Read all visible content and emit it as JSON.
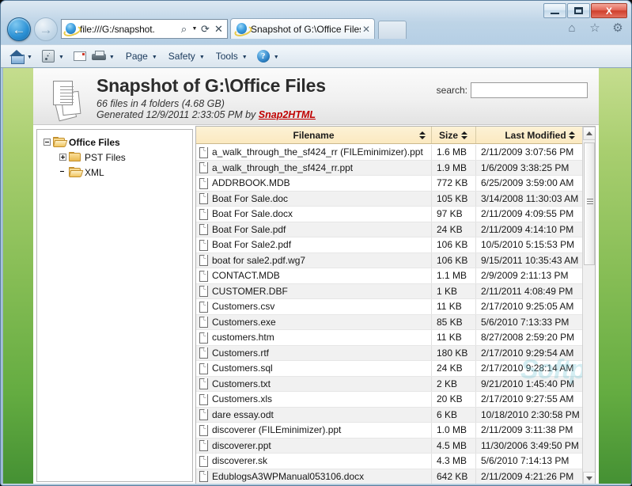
{
  "window": {
    "minimize_label": "Minimize",
    "maximize_label": "Maximize",
    "close_label": "X"
  },
  "browser": {
    "back_glyph": "←",
    "forward_glyph": "→",
    "address_value": "file:///G:/snapshot.",
    "address_search_glyph": "⌕",
    "address_caret_glyph": "▼",
    "address_refresh_glyph": "⟳",
    "address_stop_glyph": "✕",
    "tab_title": "Snapshot of G:\\Office Files",
    "tab_close_glyph": "✕",
    "home_glyph": "⌂",
    "favorites_glyph": "☆",
    "settings_glyph": "⚙"
  },
  "commandbar": {
    "items": [
      {
        "icon": "home-icon",
        "label": "",
        "caret": "▼"
      },
      {
        "icon": "rss-feeds-icon",
        "label": "",
        "caret": "▼"
      },
      {
        "icon": "mail-icon",
        "label": "",
        "caret": ""
      },
      {
        "icon": "print-icon",
        "label": "",
        "caret": "▼"
      },
      {
        "icon": "",
        "label": "Page",
        "caret": "▼"
      },
      {
        "icon": "",
        "label": "Safety",
        "caret": "▼"
      },
      {
        "icon": "",
        "label": "Tools",
        "caret": "▼"
      },
      {
        "icon": "help-icon",
        "label": "",
        "caret": "▼"
      }
    ]
  },
  "page_header": {
    "title": "Snapshot of G:\\Office Files",
    "subtitle_counts": "66 files in 4 folders (4.68 GB)",
    "subtitle_generated_prefix": "Generated 12/9/2011 2:33:05 PM by ",
    "generator_link": "Snap2HTML",
    "search_label": "search:",
    "search_value": "",
    "search_placeholder": ""
  },
  "tree": {
    "nodes": [
      {
        "label": "Office Files",
        "level": 1,
        "state": "expanded",
        "folder": "open",
        "selected": true
      },
      {
        "label": "PST Files",
        "level": 2,
        "state": "collapsed",
        "folder": "closed",
        "selected": false
      },
      {
        "label": "XML",
        "level": 2,
        "state": "leaf",
        "folder": "open",
        "selected": false
      }
    ]
  },
  "filelist": {
    "columns": [
      "Filename",
      "Size",
      "Last Modified"
    ],
    "sort_glyph": "⇅",
    "rows": [
      {
        "name": "a_walk_through_the_sf424_rr (FILEminimizer).ppt",
        "size": "1.6 MB",
        "modified": "2/11/2009 3:07:56 PM"
      },
      {
        "name": "a_walk_through_the_sf424_rr.ppt",
        "size": "1.9 MB",
        "modified": "1/6/2009 3:38:25 PM"
      },
      {
        "name": "ADDRBOOK.MDB",
        "size": "772 KB",
        "modified": "6/25/2009 3:59:00 AM"
      },
      {
        "name": "Boat For Sale.doc",
        "size": "105 KB",
        "modified": "3/14/2008 11:30:03 AM"
      },
      {
        "name": "Boat For Sale.docx",
        "size": "97 KB",
        "modified": "2/11/2009 4:09:55 PM"
      },
      {
        "name": "Boat For Sale.pdf",
        "size": "24 KB",
        "modified": "2/11/2009 4:14:10 PM"
      },
      {
        "name": "Boat For Sale2.pdf",
        "size": "106 KB",
        "modified": "10/5/2010 5:15:53 PM"
      },
      {
        "name": "boat for sale2.pdf.wg7",
        "size": "106 KB",
        "modified": "9/15/2011 10:35:43 AM"
      },
      {
        "name": "CONTACT.MDB",
        "size": "1.1 MB",
        "modified": "2/9/2009 2:11:13 PM"
      },
      {
        "name": "CUSTOMER.DBF",
        "size": "1 KB",
        "modified": "2/11/2011 4:08:49 PM"
      },
      {
        "name": "Customers.csv",
        "size": "11 KB",
        "modified": "2/17/2010 9:25:05 AM"
      },
      {
        "name": "Customers.exe",
        "size": "85 KB",
        "modified": "5/6/2010 7:13:33 PM"
      },
      {
        "name": "customers.htm",
        "size": "11 KB",
        "modified": "8/27/2008 2:59:20 PM"
      },
      {
        "name": "Customers.rtf",
        "size": "180 KB",
        "modified": "2/17/2010 9:29:54 AM"
      },
      {
        "name": "Customers.sql",
        "size": "24 KB",
        "modified": "2/17/2010 9:28:14 AM"
      },
      {
        "name": "Customers.txt",
        "size": "2 KB",
        "modified": "9/21/2010 1:45:40 PM"
      },
      {
        "name": "Customers.xls",
        "size": "20 KB",
        "modified": "2/17/2010 9:27:55 AM"
      },
      {
        "name": "dare essay.odt",
        "size": "6 KB",
        "modified": "10/18/2010 2:30:58 PM"
      },
      {
        "name": "discoverer (FILEminimizer).ppt",
        "size": "1.0 MB",
        "modified": "2/11/2009 3:11:38 PM"
      },
      {
        "name": "discoverer.ppt",
        "size": "4.5 MB",
        "modified": "11/30/2006 3:49:50 PM"
      },
      {
        "name": "discoverer.sk",
        "size": "4.3 MB",
        "modified": "5/6/2010 7:14:13 PM"
      },
      {
        "name": "EdublogsA3WPManual053106.docx",
        "size": "642 KB",
        "modified": "2/11/2009 4:21:26 PM"
      }
    ],
    "scrollbar": {
      "up_glyph": "▲",
      "down_glyph": "▼"
    }
  },
  "watermark": {
    "text": "Softpedia"
  },
  "colors": {
    "accent_green_top": "#c5dd8e",
    "accent_green_bottom": "#449033",
    "header_band": "#f1f1f1",
    "column_header": "#fbe9c0",
    "link_red": "#c00000",
    "close_red": "#cf3f2c"
  }
}
